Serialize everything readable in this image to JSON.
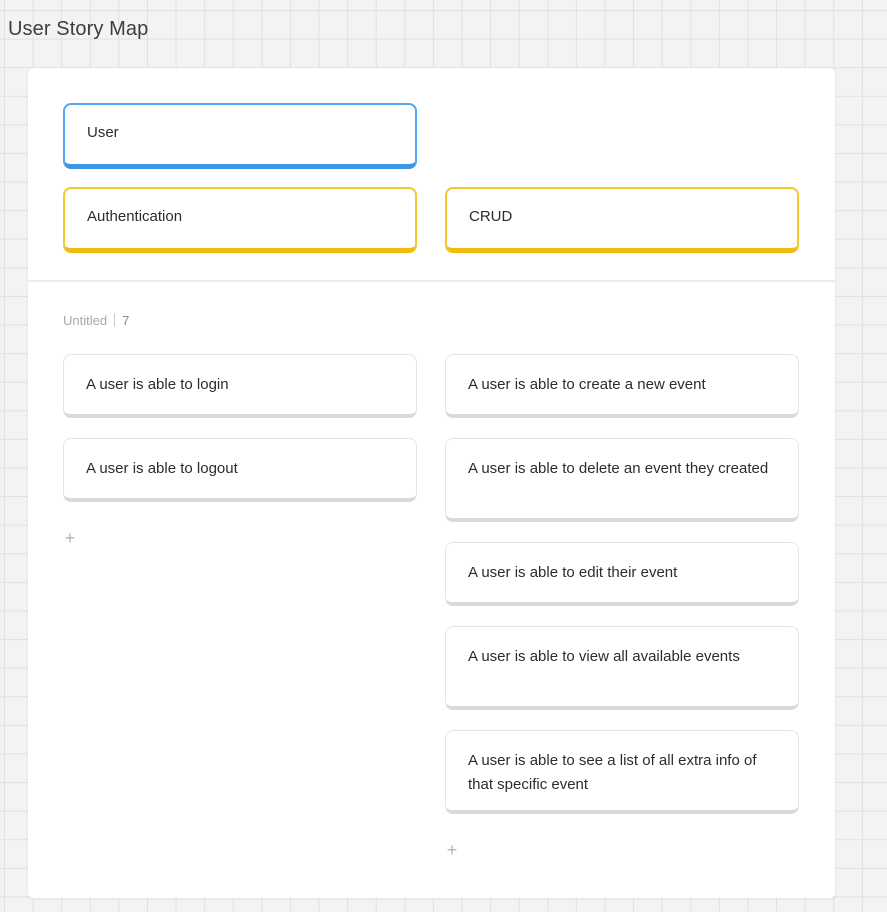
{
  "board": {
    "title": "User Story Map"
  },
  "user_activities": [
    {
      "label": "User"
    }
  ],
  "activities": [
    {
      "label": "Authentication"
    },
    {
      "label": "CRUD"
    }
  ],
  "release": {
    "name": "Untitled",
    "count": "7"
  },
  "stories": {
    "column_1": [
      {
        "text": "A user is able to login"
      },
      {
        "text": "A user is able to logout"
      }
    ],
    "column_2": [
      {
        "text": "A user is able to create a new event"
      },
      {
        "text": "A user is able to delete an event they created"
      },
      {
        "text": "A user is able to edit their event"
      },
      {
        "text": "A user is able to view all available events"
      },
      {
        "text": "A user is able to see a list of all extra info of that specific event"
      }
    ]
  },
  "controls": {
    "add_icon": "plus-icon",
    "add_glyph": "+"
  },
  "colors": {
    "user_border": "#53a6ec",
    "activity_border": "#f5c728"
  }
}
